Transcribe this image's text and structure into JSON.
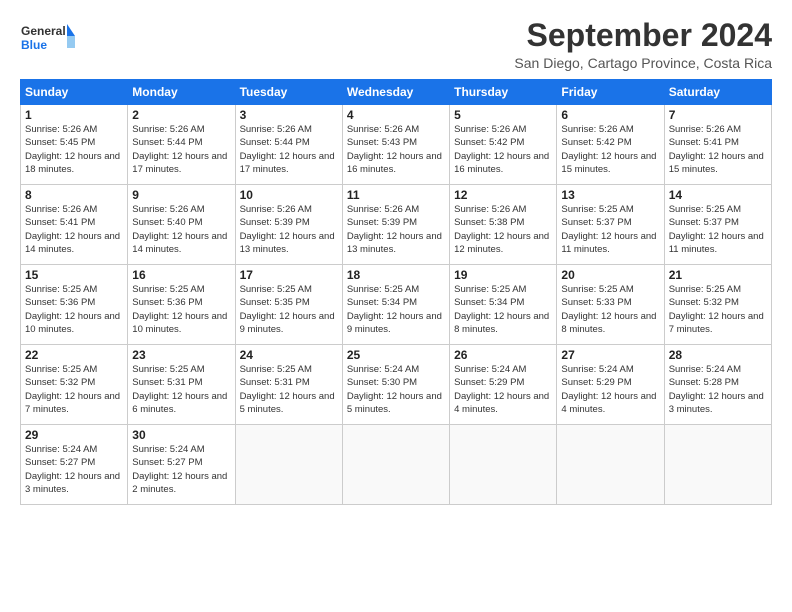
{
  "logo": {
    "text_general": "General",
    "text_blue": "Blue"
  },
  "title": {
    "month_year": "September 2024",
    "location": "San Diego, Cartago Province, Costa Rica"
  },
  "headers": [
    "Sunday",
    "Monday",
    "Tuesday",
    "Wednesday",
    "Thursday",
    "Friday",
    "Saturday"
  ],
  "weeks": [
    [
      {
        "day": "1",
        "sunrise": "5:26 AM",
        "sunset": "5:45 PM",
        "daylight": "12 hours and 18 minutes."
      },
      {
        "day": "2",
        "sunrise": "5:26 AM",
        "sunset": "5:44 PM",
        "daylight": "12 hours and 17 minutes."
      },
      {
        "day": "3",
        "sunrise": "5:26 AM",
        "sunset": "5:44 PM",
        "daylight": "12 hours and 17 minutes."
      },
      {
        "day": "4",
        "sunrise": "5:26 AM",
        "sunset": "5:43 PM",
        "daylight": "12 hours and 16 minutes."
      },
      {
        "day": "5",
        "sunrise": "5:26 AM",
        "sunset": "5:42 PM",
        "daylight": "12 hours and 16 minutes."
      },
      {
        "day": "6",
        "sunrise": "5:26 AM",
        "sunset": "5:42 PM",
        "daylight": "12 hours and 15 minutes."
      },
      {
        "day": "7",
        "sunrise": "5:26 AM",
        "sunset": "5:41 PM",
        "daylight": "12 hours and 15 minutes."
      }
    ],
    [
      {
        "day": "8",
        "sunrise": "5:26 AM",
        "sunset": "5:41 PM",
        "daylight": "12 hours and 14 minutes."
      },
      {
        "day": "9",
        "sunrise": "5:26 AM",
        "sunset": "5:40 PM",
        "daylight": "12 hours and 14 minutes."
      },
      {
        "day": "10",
        "sunrise": "5:26 AM",
        "sunset": "5:39 PM",
        "daylight": "12 hours and 13 minutes."
      },
      {
        "day": "11",
        "sunrise": "5:26 AM",
        "sunset": "5:39 PM",
        "daylight": "12 hours and 13 minutes."
      },
      {
        "day": "12",
        "sunrise": "5:26 AM",
        "sunset": "5:38 PM",
        "daylight": "12 hours and 12 minutes."
      },
      {
        "day": "13",
        "sunrise": "5:25 AM",
        "sunset": "5:37 PM",
        "daylight": "12 hours and 11 minutes."
      },
      {
        "day": "14",
        "sunrise": "5:25 AM",
        "sunset": "5:37 PM",
        "daylight": "12 hours and 11 minutes."
      }
    ],
    [
      {
        "day": "15",
        "sunrise": "5:25 AM",
        "sunset": "5:36 PM",
        "daylight": "12 hours and 10 minutes."
      },
      {
        "day": "16",
        "sunrise": "5:25 AM",
        "sunset": "5:36 PM",
        "daylight": "12 hours and 10 minutes."
      },
      {
        "day": "17",
        "sunrise": "5:25 AM",
        "sunset": "5:35 PM",
        "daylight": "12 hours and 9 minutes."
      },
      {
        "day": "18",
        "sunrise": "5:25 AM",
        "sunset": "5:34 PM",
        "daylight": "12 hours and 9 minutes."
      },
      {
        "day": "19",
        "sunrise": "5:25 AM",
        "sunset": "5:34 PM",
        "daylight": "12 hours and 8 minutes."
      },
      {
        "day": "20",
        "sunrise": "5:25 AM",
        "sunset": "5:33 PM",
        "daylight": "12 hours and 8 minutes."
      },
      {
        "day": "21",
        "sunrise": "5:25 AM",
        "sunset": "5:32 PM",
        "daylight": "12 hours and 7 minutes."
      }
    ],
    [
      {
        "day": "22",
        "sunrise": "5:25 AM",
        "sunset": "5:32 PM",
        "daylight": "12 hours and 7 minutes."
      },
      {
        "day": "23",
        "sunrise": "5:25 AM",
        "sunset": "5:31 PM",
        "daylight": "12 hours and 6 minutes."
      },
      {
        "day": "24",
        "sunrise": "5:25 AM",
        "sunset": "5:31 PM",
        "daylight": "12 hours and 5 minutes."
      },
      {
        "day": "25",
        "sunrise": "5:24 AM",
        "sunset": "5:30 PM",
        "daylight": "12 hours and 5 minutes."
      },
      {
        "day": "26",
        "sunrise": "5:24 AM",
        "sunset": "5:29 PM",
        "daylight": "12 hours and 4 minutes."
      },
      {
        "day": "27",
        "sunrise": "5:24 AM",
        "sunset": "5:29 PM",
        "daylight": "12 hours and 4 minutes."
      },
      {
        "day": "28",
        "sunrise": "5:24 AM",
        "sunset": "5:28 PM",
        "daylight": "12 hours and 3 minutes."
      }
    ],
    [
      {
        "day": "29",
        "sunrise": "5:24 AM",
        "sunset": "5:27 PM",
        "daylight": "12 hours and 3 minutes."
      },
      {
        "day": "30",
        "sunrise": "5:24 AM",
        "sunset": "5:27 PM",
        "daylight": "12 hours and 2 minutes."
      },
      null,
      null,
      null,
      null,
      null
    ]
  ]
}
